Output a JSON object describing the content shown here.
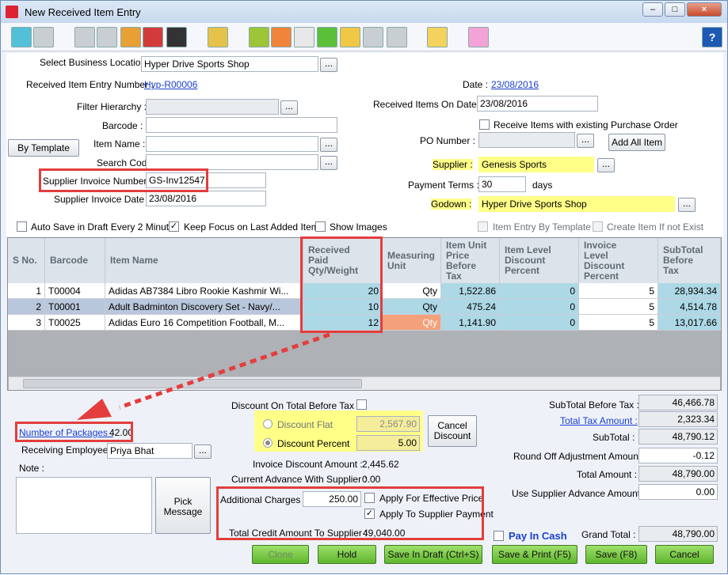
{
  "window": {
    "title": "New Received Item Entry",
    "minimize": "–",
    "maximize": "□",
    "close": "×",
    "help": "?"
  },
  "colors": {
    "accent": "#1a3fd0",
    "highlight": "#ffff88",
    "annotation_red": "#e43d3d",
    "row_selected": "#b9c7dc",
    "cell_blue": "#add8e6",
    "cell_orange": "#f4a07a",
    "button_green": "#6ec43c"
  },
  "toolbar": {
    "icons": [
      "cart-icon",
      "list-icon",
      "back-icon",
      "forward-icon",
      "chart-icon",
      "card-icon",
      "person-add-icon",
      "book-icon",
      "calculator-icon",
      "table-icon",
      "calendar-icon",
      "plus-icon",
      "hierarchy-icon",
      "ruler-icon",
      "code-icon",
      "badge-icon",
      "percent-icon"
    ]
  },
  "form": {
    "business_location_label": "Select Business Location :",
    "business_location": "Hyper Drive Sports Shop",
    "entry_number_label": "Received Item Entry Number :",
    "entry_number": "Hyp-R00006",
    "date_label": "Date :",
    "date": "23/08/2016",
    "filter_hierarchy_label": "Filter Hierarchy :",
    "received_on_date_label": "Received Items On Date :",
    "received_on_date": "23/08/2016",
    "barcode_label": "Barcode :",
    "receive_po_label": "Receive Items with existing Purchase Order",
    "by_template_label": "By Template",
    "item_name_label": "Item Name :",
    "po_number_label": "PO Number :",
    "add_all_item_label": "Add All Item",
    "search_code_label": "Search Code :",
    "supplier_label": "Supplier :",
    "supplier": "Genesis Sports",
    "supplier_invoice_number_label": "Supplier Invoice Number :",
    "supplier_invoice_number": "GS-Inv12547",
    "payment_terms_label": "Payment Terms :",
    "payment_terms": "30",
    "payment_terms_unit": "days",
    "supplier_invoice_date_label": "Supplier Invoice Date :",
    "supplier_invoice_date": "23/08/2016",
    "godown_label": "Godown :",
    "godown": "Hyper Drive Sports Shop",
    "auto_save_label": "Auto Save in Draft Every 2 Minutes",
    "keep_focus_label": "Keep Focus on Last Added Item",
    "show_images_label": "Show Images",
    "item_entry_template_label": "Item Entry By Template",
    "create_item_label": "Create Item If not Exist",
    "dots": "..."
  },
  "grid": {
    "headers": [
      "S No.",
      "Barcode",
      "Item Name",
      "Received\nPaid\nQty/Weight",
      "Measuring\nUnit",
      "Item Unit\nPrice\nBefore\nTax",
      "Item Level\nDiscount\nPercent",
      "Invoice\nLevel\nDiscount\nPercent",
      "SubTotal\nBefore\nTax"
    ],
    "rows": [
      {
        "sno": "1",
        "barcode": "T00004",
        "name": "Adidas AB7384 Libro Rookie Kashmir Wi...",
        "qty": "20",
        "unit": "Qty",
        "price": "1,522.86",
        "item_disc": "0",
        "inv_disc": "5",
        "subtotal": "28,934.34"
      },
      {
        "sno": "2",
        "barcode": "T00001",
        "name": "Adult Badminton Discovery Set - Navy/...",
        "qty": "10",
        "unit": "Qty",
        "price": "475.24",
        "item_disc": "0",
        "inv_disc": "5",
        "subtotal": "4,514.78"
      },
      {
        "sno": "3",
        "barcode": "T00025",
        "name": "Adidas Euro 16 Competition Football, M...",
        "qty": "12",
        "unit": "Qty",
        "price": "1,141.90",
        "item_disc": "0",
        "inv_disc": "5",
        "subtotal": "13,017.66"
      }
    ]
  },
  "bottom": {
    "packages_label": "Number of Packages :",
    "packages": "42.00",
    "employee_label": "Receiving Employee :",
    "employee": "Priya Bhat",
    "note_label": "Note :",
    "pick_message_label": "Pick\nMessage",
    "discount_total_label": "Discount On Total Before Tax :",
    "discount_flat_label": "Discount Flat",
    "discount_flat": "2,567.90",
    "discount_percent_label": "Discount Percent",
    "discount_percent": "5.00",
    "cancel_discount_label": "Cancel\nDiscount",
    "invoice_discount_label": "Invoice Discount Amount :",
    "invoice_discount": "2,445.62",
    "current_advance_label": "Current Advance With Supplier :",
    "current_advance": "0.00",
    "additional_charges_label": "Additional Charges :",
    "additional_charges": "250.00",
    "apply_effective_label": "Apply For Effective Price",
    "apply_supplier_label": "Apply To Supplier Payment",
    "total_credit_label": "Total Credit Amount To Supplier :",
    "total_credit": "49,040.00",
    "subtotal_before_tax_label": "SubTotal Before Tax :",
    "subtotal_before_tax": "46,466.78",
    "total_tax_label": "Total Tax Amount :",
    "total_tax": "2,323.34",
    "subtotal_label": "SubTotal :",
    "subtotal": "48,790.12",
    "roundoff_label": "Round Off Adjustment Amount :",
    "roundoff": "-0.12",
    "total_amount_label": "Total Amount :",
    "total_amount": "48,790.00",
    "use_advance_label": "Use Supplier Advance Amount :",
    "use_advance": "0.00",
    "pay_in_cash_label": "Pay In Cash",
    "grand_total_label": "Grand Total :",
    "grand_total": "48,790.00"
  },
  "actions": {
    "clone": "Clone",
    "hold": "Hold",
    "save_draft": "Save In Draft (Ctrl+S)",
    "save_print": "Save & Print (F5)",
    "save": "Save (F8)",
    "cancel": "Cancel"
  }
}
